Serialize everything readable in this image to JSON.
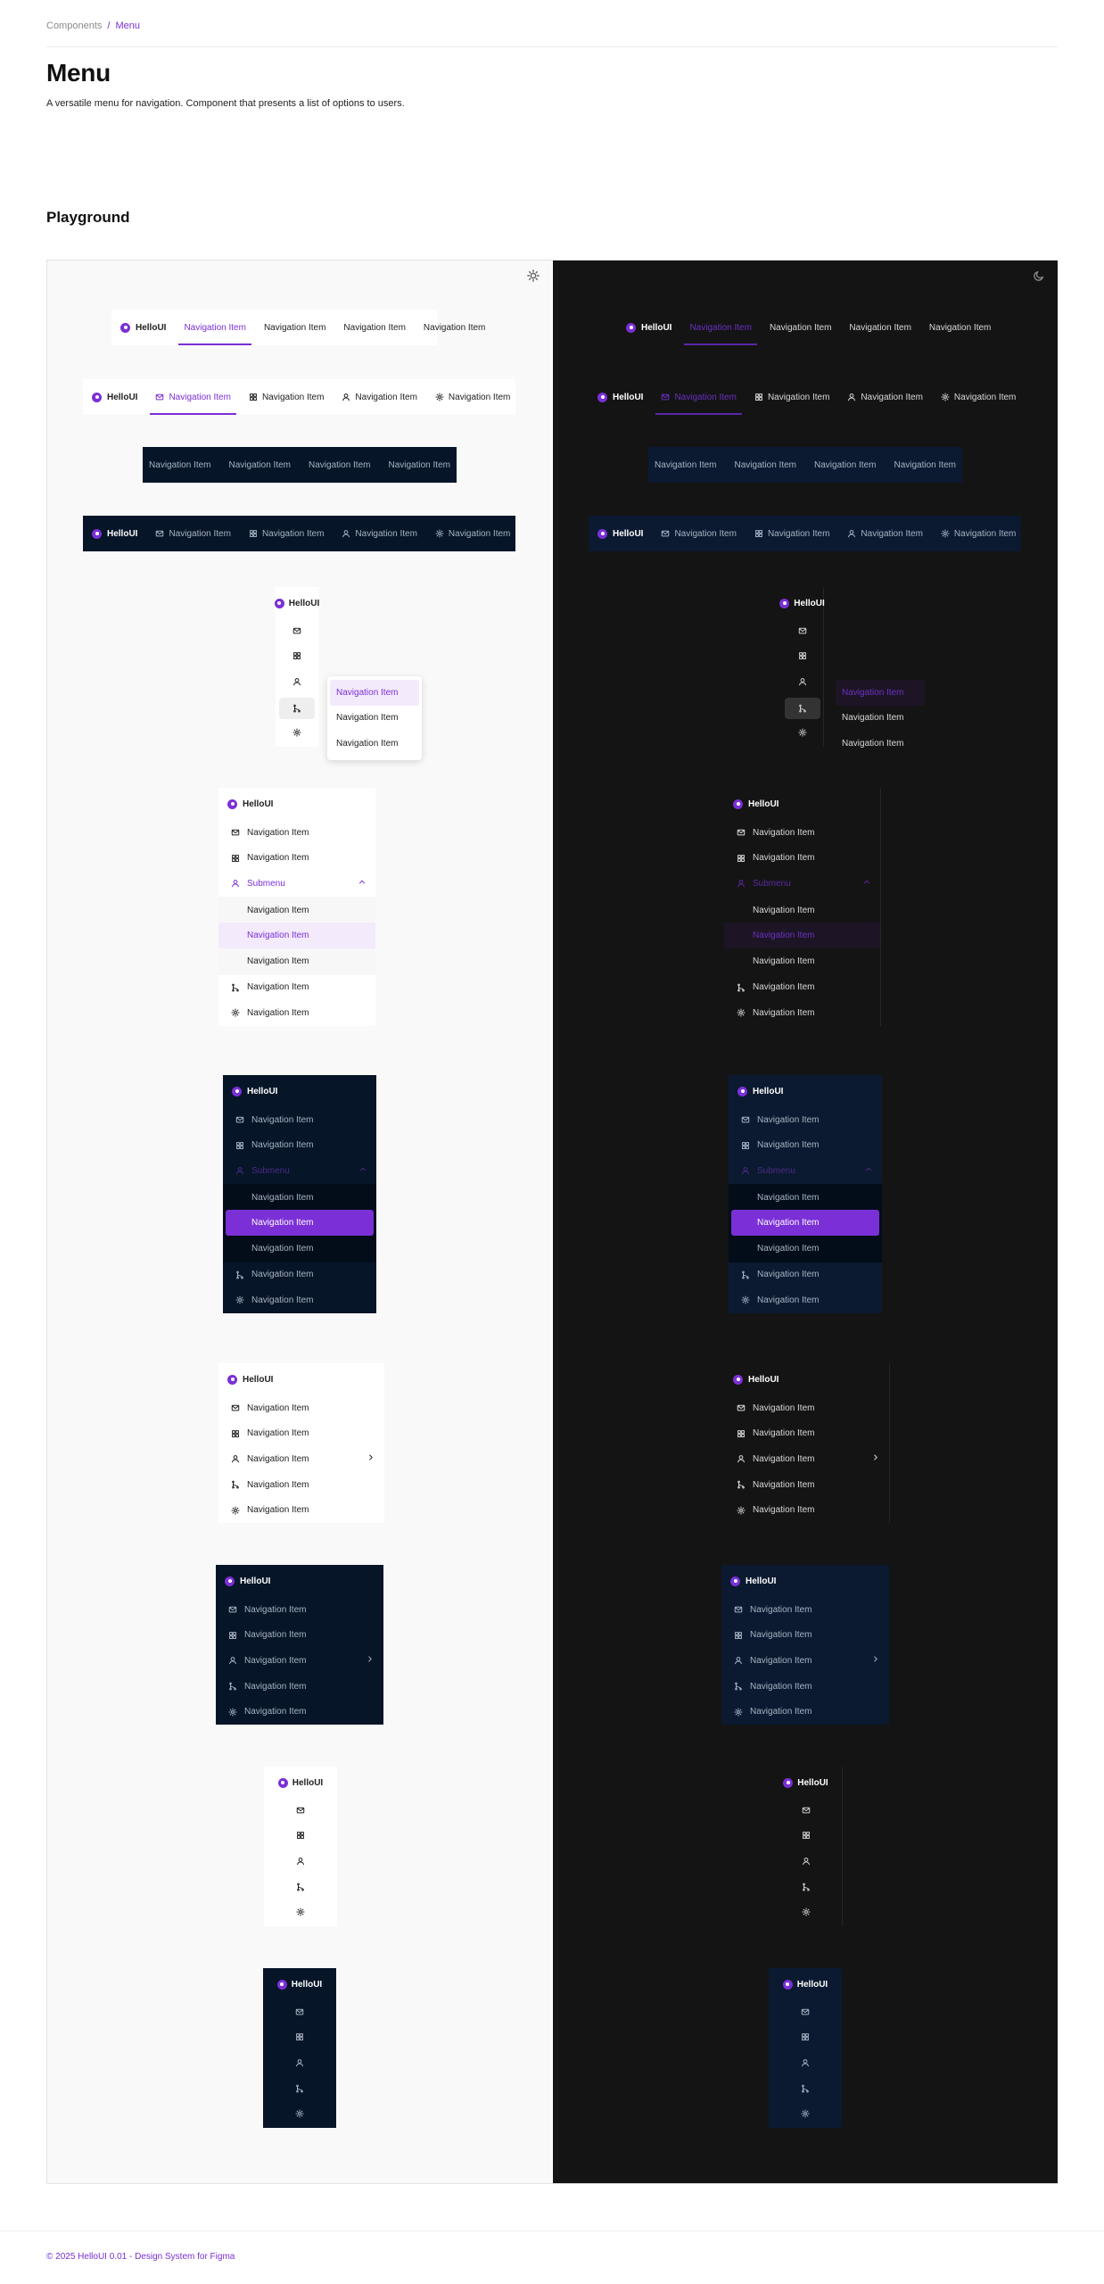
{
  "breadcrumb": {
    "parent": "Components",
    "separator": "/",
    "current": "Menu"
  },
  "page": {
    "title": "Menu",
    "description": "A versatile menu for navigation. Component that presents a list of options to users."
  },
  "section": {
    "title": "Playground"
  },
  "brand": "HelloUI",
  "item_label": "Navigation Item",
  "submenu_label": "Submenu",
  "icons": [
    "mail-icon",
    "grid-icon",
    "user-icon",
    "branch-icon",
    "settings-icon"
  ],
  "theme_toggles": {
    "light": "sun-icon",
    "dark": "moon-icon"
  },
  "colors": {
    "accent": "#7b2fd6",
    "navy": "#061528",
    "dark_bg": "#141414",
    "light_bg": "#f9f9f9"
  },
  "footer": {
    "text": "© 2025 HelloUI 0.01 - Design System for Figma"
  }
}
